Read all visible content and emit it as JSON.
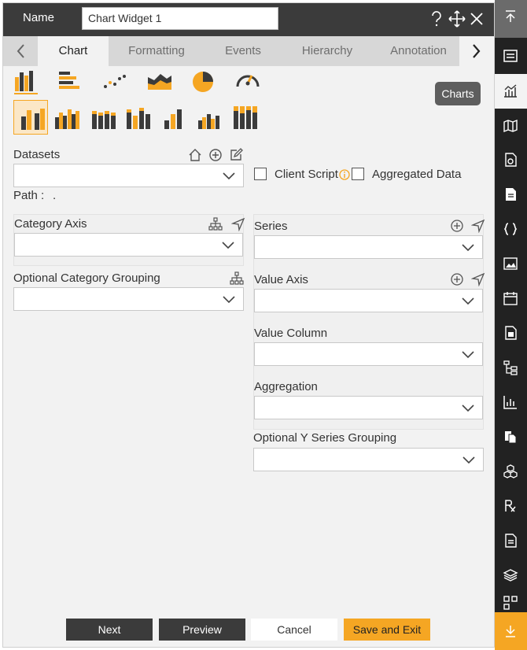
{
  "header": {
    "name_label": "Name",
    "name_value": "Chart Widget 1"
  },
  "tabs": [
    {
      "label": "Chart",
      "active": true
    },
    {
      "label": "Formatting",
      "active": false
    },
    {
      "label": "Events",
      "active": false
    },
    {
      "label": "Hierarchy",
      "active": false
    },
    {
      "label": "Annotation",
      "active": false
    }
  ],
  "charts_tooltip": "Charts",
  "datasets": {
    "label": "Datasets",
    "value": "",
    "path_label": "Path :",
    "path_value": "."
  },
  "client_script": {
    "label": "Client Script",
    "checked": false
  },
  "aggregated_data": {
    "label": "Aggregated Data",
    "checked": false
  },
  "category_axis": {
    "label": "Category Axis",
    "value": ""
  },
  "optional_category_grouping": {
    "label": "Optional Category Grouping",
    "value": ""
  },
  "series": {
    "label": "Series",
    "value": ""
  },
  "value_axis": {
    "label": "Value Axis",
    "value": ""
  },
  "value_column": {
    "label": "Value Column",
    "value": ""
  },
  "aggregation": {
    "label": "Aggregation",
    "value": ""
  },
  "optional_y_series_grouping": {
    "label": "Optional Y Series Grouping",
    "value": ""
  },
  "buttons": {
    "next": "Next",
    "preview": "Preview",
    "cancel": "Cancel",
    "save_exit": "Save and Exit"
  },
  "colors": {
    "accent": "#f5a623",
    "header_bg": "#3b3b3b",
    "sidebar_bg": "#222222"
  },
  "chart_types": [
    "column-chart-icon",
    "bar-chart-icon",
    "scatter-chart-icon",
    "area-chart-icon",
    "pie-chart-icon",
    "gauge-chart-icon"
  ],
  "chart_subtypes": [
    "clustered-column-icon",
    "grouped-column-icon",
    "stacked-column-icon",
    "stacked-column-alt-icon",
    "column-3d-icon",
    "column-small-multiple-icon",
    "column-100-percent-icon"
  ],
  "sidebar_icons": [
    "move-to-top-icon",
    "form-widget-icon",
    "chart-widget-icon",
    "map-widget-icon",
    "report-widget-icon",
    "document-widget-icon",
    "script-widget-icon",
    "image-widget-icon",
    "calendar-widget-icon",
    "calculator-widget-icon",
    "tree-widget-icon",
    "kpi-widget-icon",
    "pages-widget-icon",
    "cube-widget-icon",
    "rx-widget-icon",
    "list-widget-icon",
    "layers-widget-icon",
    "grid-widget-icon",
    "move-to-bottom-icon"
  ]
}
